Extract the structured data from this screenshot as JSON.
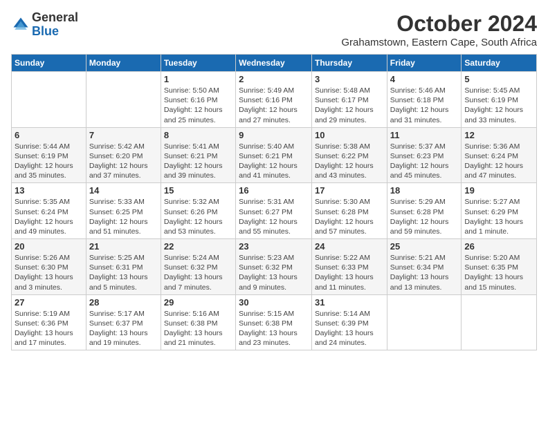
{
  "logo": {
    "general": "General",
    "blue": "Blue"
  },
  "header": {
    "month": "October 2024",
    "location": "Grahamstown, Eastern Cape, South Africa"
  },
  "days_of_week": [
    "Sunday",
    "Monday",
    "Tuesday",
    "Wednesday",
    "Thursday",
    "Friday",
    "Saturday"
  ],
  "weeks": [
    [
      {
        "day": "",
        "info": ""
      },
      {
        "day": "",
        "info": ""
      },
      {
        "day": "1",
        "info": "Sunrise: 5:50 AM\nSunset: 6:16 PM\nDaylight: 12 hours and 25 minutes."
      },
      {
        "day": "2",
        "info": "Sunrise: 5:49 AM\nSunset: 6:16 PM\nDaylight: 12 hours and 27 minutes."
      },
      {
        "day": "3",
        "info": "Sunrise: 5:48 AM\nSunset: 6:17 PM\nDaylight: 12 hours and 29 minutes."
      },
      {
        "day": "4",
        "info": "Sunrise: 5:46 AM\nSunset: 6:18 PM\nDaylight: 12 hours and 31 minutes."
      },
      {
        "day": "5",
        "info": "Sunrise: 5:45 AM\nSunset: 6:19 PM\nDaylight: 12 hours and 33 minutes."
      }
    ],
    [
      {
        "day": "6",
        "info": "Sunrise: 5:44 AM\nSunset: 6:19 PM\nDaylight: 12 hours and 35 minutes."
      },
      {
        "day": "7",
        "info": "Sunrise: 5:42 AM\nSunset: 6:20 PM\nDaylight: 12 hours and 37 minutes."
      },
      {
        "day": "8",
        "info": "Sunrise: 5:41 AM\nSunset: 6:21 PM\nDaylight: 12 hours and 39 minutes."
      },
      {
        "day": "9",
        "info": "Sunrise: 5:40 AM\nSunset: 6:21 PM\nDaylight: 12 hours and 41 minutes."
      },
      {
        "day": "10",
        "info": "Sunrise: 5:38 AM\nSunset: 6:22 PM\nDaylight: 12 hours and 43 minutes."
      },
      {
        "day": "11",
        "info": "Sunrise: 5:37 AM\nSunset: 6:23 PM\nDaylight: 12 hours and 45 minutes."
      },
      {
        "day": "12",
        "info": "Sunrise: 5:36 AM\nSunset: 6:24 PM\nDaylight: 12 hours and 47 minutes."
      }
    ],
    [
      {
        "day": "13",
        "info": "Sunrise: 5:35 AM\nSunset: 6:24 PM\nDaylight: 12 hours and 49 minutes."
      },
      {
        "day": "14",
        "info": "Sunrise: 5:33 AM\nSunset: 6:25 PM\nDaylight: 12 hours and 51 minutes."
      },
      {
        "day": "15",
        "info": "Sunrise: 5:32 AM\nSunset: 6:26 PM\nDaylight: 12 hours and 53 minutes."
      },
      {
        "day": "16",
        "info": "Sunrise: 5:31 AM\nSunset: 6:27 PM\nDaylight: 12 hours and 55 minutes."
      },
      {
        "day": "17",
        "info": "Sunrise: 5:30 AM\nSunset: 6:28 PM\nDaylight: 12 hours and 57 minutes."
      },
      {
        "day": "18",
        "info": "Sunrise: 5:29 AM\nSunset: 6:28 PM\nDaylight: 12 hours and 59 minutes."
      },
      {
        "day": "19",
        "info": "Sunrise: 5:27 AM\nSunset: 6:29 PM\nDaylight: 13 hours and 1 minute."
      }
    ],
    [
      {
        "day": "20",
        "info": "Sunrise: 5:26 AM\nSunset: 6:30 PM\nDaylight: 13 hours and 3 minutes."
      },
      {
        "day": "21",
        "info": "Sunrise: 5:25 AM\nSunset: 6:31 PM\nDaylight: 13 hours and 5 minutes."
      },
      {
        "day": "22",
        "info": "Sunrise: 5:24 AM\nSunset: 6:32 PM\nDaylight: 13 hours and 7 minutes."
      },
      {
        "day": "23",
        "info": "Sunrise: 5:23 AM\nSunset: 6:32 PM\nDaylight: 13 hours and 9 minutes."
      },
      {
        "day": "24",
        "info": "Sunrise: 5:22 AM\nSunset: 6:33 PM\nDaylight: 13 hours and 11 minutes."
      },
      {
        "day": "25",
        "info": "Sunrise: 5:21 AM\nSunset: 6:34 PM\nDaylight: 13 hours and 13 minutes."
      },
      {
        "day": "26",
        "info": "Sunrise: 5:20 AM\nSunset: 6:35 PM\nDaylight: 13 hours and 15 minutes."
      }
    ],
    [
      {
        "day": "27",
        "info": "Sunrise: 5:19 AM\nSunset: 6:36 PM\nDaylight: 13 hours and 17 minutes."
      },
      {
        "day": "28",
        "info": "Sunrise: 5:17 AM\nSunset: 6:37 PM\nDaylight: 13 hours and 19 minutes."
      },
      {
        "day": "29",
        "info": "Sunrise: 5:16 AM\nSunset: 6:38 PM\nDaylight: 13 hours and 21 minutes."
      },
      {
        "day": "30",
        "info": "Sunrise: 5:15 AM\nSunset: 6:38 PM\nDaylight: 13 hours and 23 minutes."
      },
      {
        "day": "31",
        "info": "Sunrise: 5:14 AM\nSunset: 6:39 PM\nDaylight: 13 hours and 24 minutes."
      },
      {
        "day": "",
        "info": ""
      },
      {
        "day": "",
        "info": ""
      }
    ]
  ]
}
